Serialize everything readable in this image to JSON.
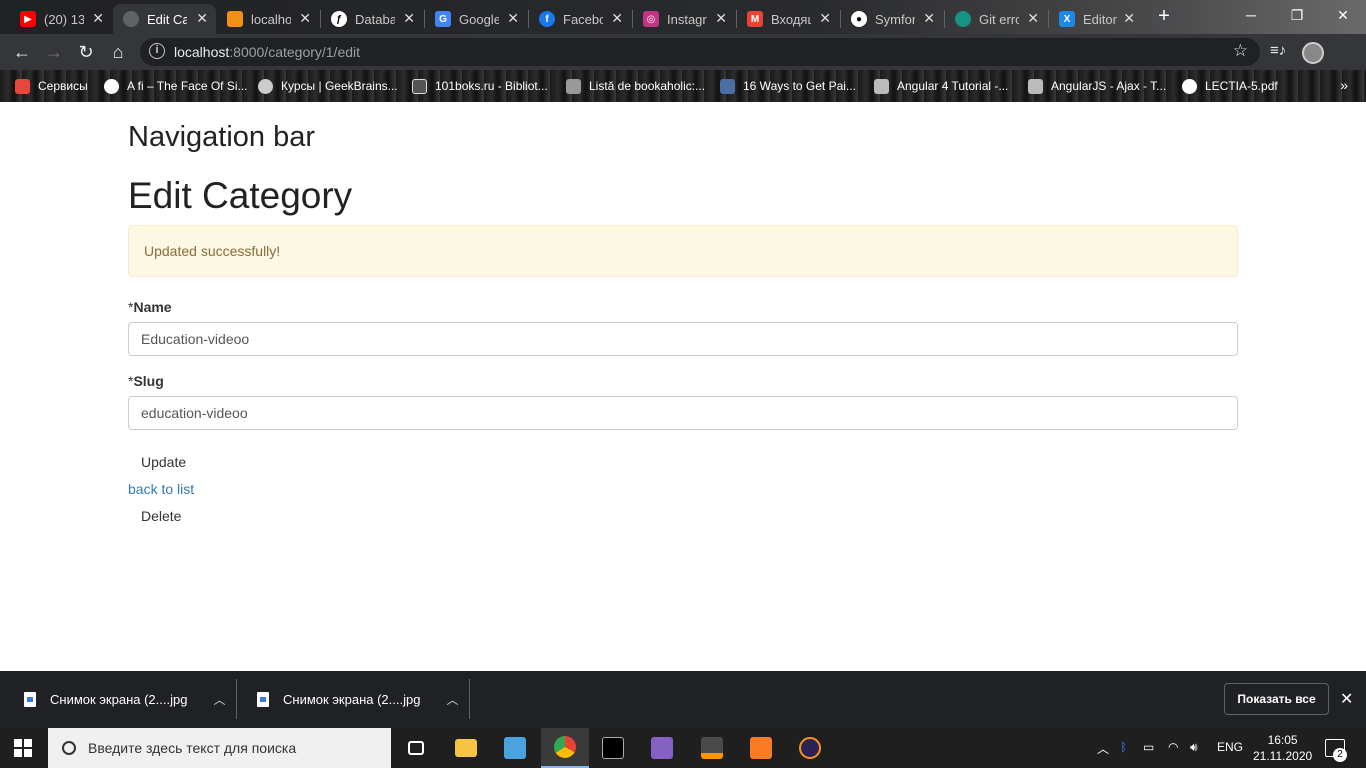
{
  "browser": {
    "tabs": [
      {
        "title": "(20) 13",
        "icon": "youtube-icon",
        "color": "#ff0000"
      },
      {
        "title": "Edit Ca",
        "icon": "loading-icon",
        "color": "#5f6368"
      },
      {
        "title": "localho",
        "icon": "phpmyadmin-icon",
        "color": "#f29111"
      },
      {
        "title": "Databa",
        "icon": "symfony-icon",
        "color": "#ffffff"
      },
      {
        "title": "Google",
        "icon": "google-translate-icon",
        "color": "#4285f4"
      },
      {
        "title": "Facebo",
        "icon": "facebook-icon",
        "color": "#1877f2"
      },
      {
        "title": "Instagr",
        "icon": "instagram-icon",
        "color": "#c13584"
      },
      {
        "title": "Входящ",
        "icon": "gmail-icon",
        "color": "#ea4335"
      },
      {
        "title": "Symfor",
        "icon": "github-icon",
        "color": "#ffffff"
      },
      {
        "title": "Git erro",
        "icon": "gitkraken-icon",
        "color": "#179287"
      },
      {
        "title": "Editor",
        "icon": "xampp-editor-icon",
        "color": "#1e88e5"
      }
    ],
    "url_host": "localhost",
    "url_path": ":8000/category/1/edit",
    "bookmarks": [
      {
        "label": "Сервисы",
        "icon": "apps-grid-icon"
      },
      {
        "label": "A fi – The Face Of Si...",
        "icon": "wordpress-icon"
      },
      {
        "label": "Курсы | GeekBrains...",
        "icon": "geekbrains-icon"
      },
      {
        "label": "101boks.ru - Bibliot...",
        "icon": "book-icon"
      },
      {
        "label": "Listă de bookaholic:...",
        "icon": "bookmark-icon"
      },
      {
        "label": "16 Ways to Get Pai...",
        "icon": "site-icon"
      },
      {
        "label": "Angular 4 Tutorial -...",
        "icon": "angular-icon"
      },
      {
        "label": "AngularJS - Ajax - T...",
        "icon": "angular-icon"
      },
      {
        "label": "LECTIA-5.pdf",
        "icon": "pdf-icon"
      }
    ],
    "bookmarks_more": "»"
  },
  "page": {
    "nav_title": "Navigation bar",
    "title": "Edit Category",
    "alert": "Updated successfully!",
    "name_label": "Name",
    "name_required": "*",
    "name_value": "Education-videoo",
    "slug_label": "Slug",
    "slug_required": "*",
    "slug_value": "education-videoo",
    "update_label": "Update",
    "back_label": "back to list",
    "delete_label": "Delete"
  },
  "downloads": {
    "items": [
      {
        "name": "Снимок экрана (2....jpg"
      },
      {
        "name": "Снимок экрана (2....jpg"
      }
    ],
    "show_all": "Показать все"
  },
  "taskbar": {
    "search_placeholder": "Введите здесь текст для поиска",
    "lang": "ENG",
    "time": "16:05",
    "date": "21.11.2020",
    "notifications": "2"
  }
}
